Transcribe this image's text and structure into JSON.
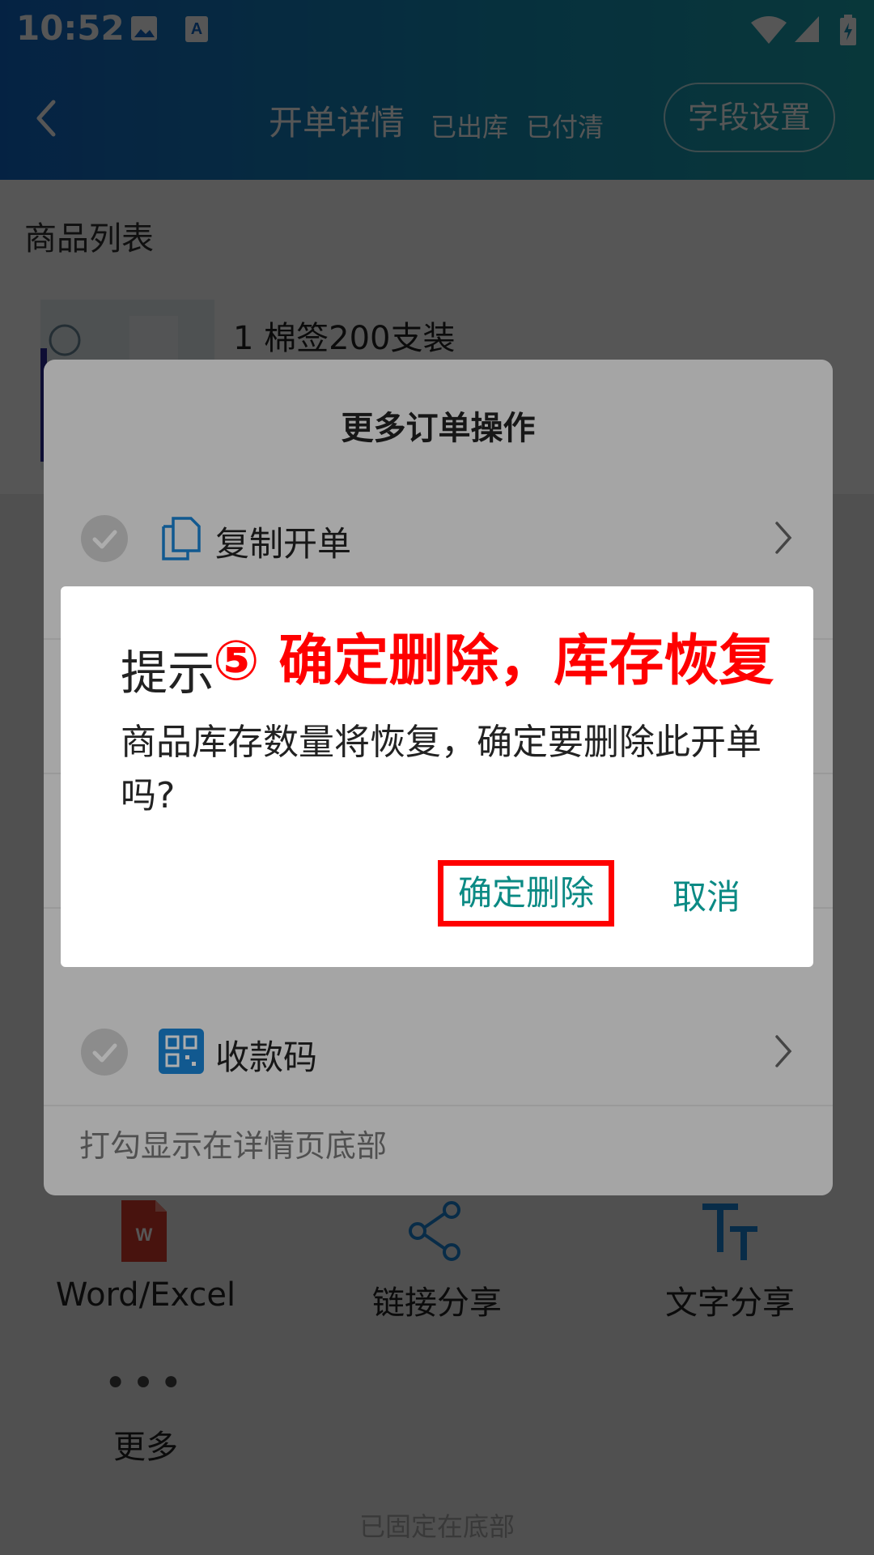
{
  "status_bar": {
    "time": "10:52"
  },
  "navbar": {
    "title": "开单详情",
    "status_shipped": "已出库",
    "status_paid": "已付清",
    "field_settings": "字段设置"
  },
  "section": {
    "title": "商品列表"
  },
  "product": {
    "name": "1 棉签200支装"
  },
  "share": {
    "word_excel": "Word/Excel",
    "link": "链接分享",
    "text": "文字分享",
    "more_dots": "•••",
    "more": "更多",
    "pinned_note": "已固定在底部"
  },
  "sheet": {
    "title": "更多订单操作",
    "items": [
      {
        "label": "复制开单"
      },
      {
        "label": "收款码"
      }
    ],
    "note": "打勾显示在详情页底部"
  },
  "dialog": {
    "title": "提示",
    "annotation": "⑤ 确定删除，库存恢复",
    "message": "商品库存数量将恢复，确定要删除此开单吗?",
    "confirm": "确定删除",
    "cancel": "取消"
  },
  "colors": {
    "header_start": "#1167c8",
    "header_end": "#1aa3ad",
    "accent_teal": "#0b8a84",
    "annotation_red": "#ff0000",
    "icon_blue": "#1a83d4"
  }
}
